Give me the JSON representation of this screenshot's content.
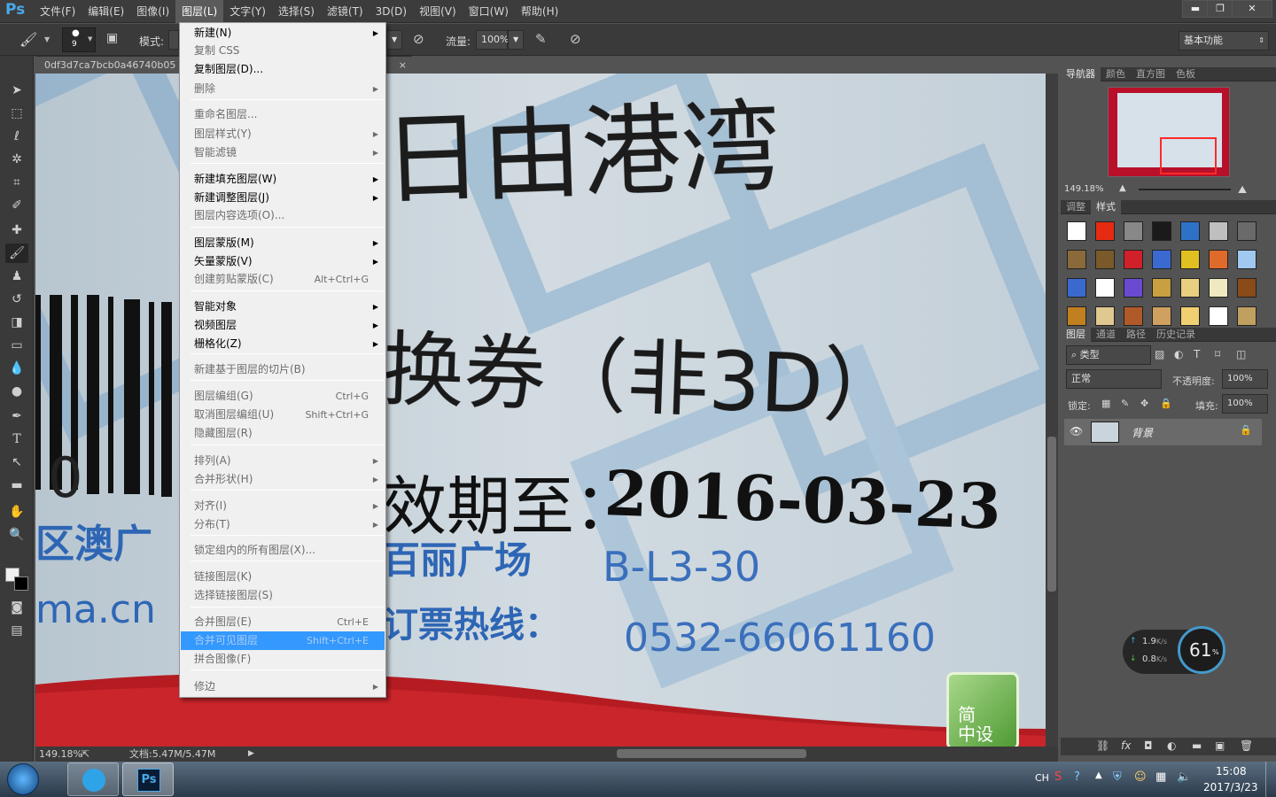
{
  "app": {
    "logo": "Ps"
  },
  "menubar": {
    "items": [
      "文件(F)",
      "编辑(E)",
      "图像(I)",
      "图层(L)",
      "文字(Y)",
      "选择(S)",
      "滤镜(T)",
      "3D(D)",
      "视图(V)",
      "窗口(W)",
      "帮助(H)"
    ],
    "active_index": 3
  },
  "window_controls": {
    "minimize": "▬",
    "restore": "❐",
    "close": "✕"
  },
  "options_bar": {
    "brush_size": "9",
    "mode_label": "模式:",
    "flow_label": "流量:",
    "flow_value": "100%",
    "workspace": "基本功能"
  },
  "document": {
    "tab_title": "0df3d7ca7bcb0a46740b05",
    "tab_close": "×",
    "zoom": "149.18%",
    "doc_size": "文档:5.47M/5.47M"
  },
  "canvas_text": {
    "line1": "日由港湾",
    "line2": "换券（非3D）",
    "line3_prefix": "效期至：",
    "line3_date": "2016-03-23",
    "line4": "区澳广",
    "line5": "百丽广场",
    "line5_code": "B-L3-30",
    "line6": "ma.cn",
    "line7": "订票热线：",
    "line7_phone": "0532-66061160",
    "barcode_digit": "0"
  },
  "watermark": {
    "line1": "简",
    "line2": "中设"
  },
  "layer_menu": {
    "items": [
      {
        "label": "新建(N)",
        "shortcut": "",
        "submenu": true,
        "disabled": false
      },
      {
        "label": "复制 CSS",
        "shortcut": "",
        "submenu": false,
        "disabled": true
      },
      {
        "label": "复制图层(D)...",
        "shortcut": "",
        "submenu": false,
        "disabled": false
      },
      {
        "label": "删除",
        "shortcut": "",
        "submenu": true,
        "disabled": true
      },
      {
        "label": "重命名图层...",
        "shortcut": "",
        "submenu": false,
        "disabled": true
      },
      {
        "label": "图层样式(Y)",
        "shortcut": "",
        "submenu": true,
        "disabled": true
      },
      {
        "label": "智能滤镜",
        "shortcut": "",
        "submenu": true,
        "disabled": true
      },
      {
        "label": "新建填充图层(W)",
        "shortcut": "",
        "submenu": true,
        "disabled": false
      },
      {
        "label": "新建调整图层(J)",
        "shortcut": "",
        "submenu": true,
        "disabled": false
      },
      {
        "label": "图层内容选项(O)...",
        "shortcut": "",
        "submenu": false,
        "disabled": true
      },
      {
        "label": "图层蒙版(M)",
        "shortcut": "",
        "submenu": true,
        "disabled": false
      },
      {
        "label": "矢量蒙版(V)",
        "shortcut": "",
        "submenu": true,
        "disabled": false
      },
      {
        "label": "创建剪贴蒙版(C)",
        "shortcut": "Alt+Ctrl+G",
        "submenu": false,
        "disabled": true
      },
      {
        "label": "智能对象",
        "shortcut": "",
        "submenu": true,
        "disabled": false
      },
      {
        "label": "视频图层",
        "shortcut": "",
        "submenu": true,
        "disabled": false
      },
      {
        "label": "栅格化(Z)",
        "shortcut": "",
        "submenu": true,
        "disabled": false
      },
      {
        "label": "新建基于图层的切片(B)",
        "shortcut": "",
        "submenu": false,
        "disabled": true
      },
      {
        "label": "图层编组(G)",
        "shortcut": "Ctrl+G",
        "submenu": false,
        "disabled": true
      },
      {
        "label": "取消图层编组(U)",
        "shortcut": "Shift+Ctrl+G",
        "submenu": false,
        "disabled": true
      },
      {
        "label": "隐藏图层(R)",
        "shortcut": "",
        "submenu": false,
        "disabled": true
      },
      {
        "label": "排列(A)",
        "shortcut": "",
        "submenu": true,
        "disabled": true
      },
      {
        "label": "合并形状(H)",
        "shortcut": "",
        "submenu": true,
        "disabled": true
      },
      {
        "label": "对齐(I)",
        "shortcut": "",
        "submenu": true,
        "disabled": true
      },
      {
        "label": "分布(T)",
        "shortcut": "",
        "submenu": true,
        "disabled": true
      },
      {
        "label": "锁定组内的所有图层(X)...",
        "shortcut": "",
        "submenu": false,
        "disabled": true
      },
      {
        "label": "链接图层(K)",
        "shortcut": "",
        "submenu": false,
        "disabled": true
      },
      {
        "label": "选择链接图层(S)",
        "shortcut": "",
        "submenu": false,
        "disabled": true
      },
      {
        "label": "合并图层(E)",
        "shortcut": "Ctrl+E",
        "submenu": false,
        "disabled": true
      },
      {
        "label": "合并可见图层",
        "shortcut": "Shift+Ctrl+E",
        "submenu": false,
        "disabled": true,
        "highlighted": true
      },
      {
        "label": "拼合图像(F)",
        "shortcut": "",
        "submenu": false,
        "disabled": true
      },
      {
        "label": "修边",
        "shortcut": "",
        "submenu": true,
        "disabled": true
      }
    ]
  },
  "navigator": {
    "tabs": [
      "导航器",
      "颜色",
      "直方图",
      "色板"
    ],
    "zoom": "149.18%"
  },
  "styles_panel": {
    "tabs": [
      "调整",
      "样式"
    ],
    "active": 1
  },
  "layers_panel": {
    "tabs": [
      "图层",
      "通道",
      "路径",
      "历史记录"
    ],
    "filter": "类型",
    "blend_mode": "正常",
    "opacity_label": "不透明度:",
    "opacity": "100%",
    "lock_label": "锁定:",
    "fill_label": "填充:",
    "fill": "100%",
    "layer_name": "背景"
  },
  "net_widget": {
    "up": "1.9",
    "down": "0.8",
    "unit": "K/s",
    "percent": "61",
    "percent_sign": "%"
  },
  "taskbar": {
    "lang": "CH",
    "time": "15:08",
    "date": "2017/3/23",
    "ps_label": "Ps"
  }
}
